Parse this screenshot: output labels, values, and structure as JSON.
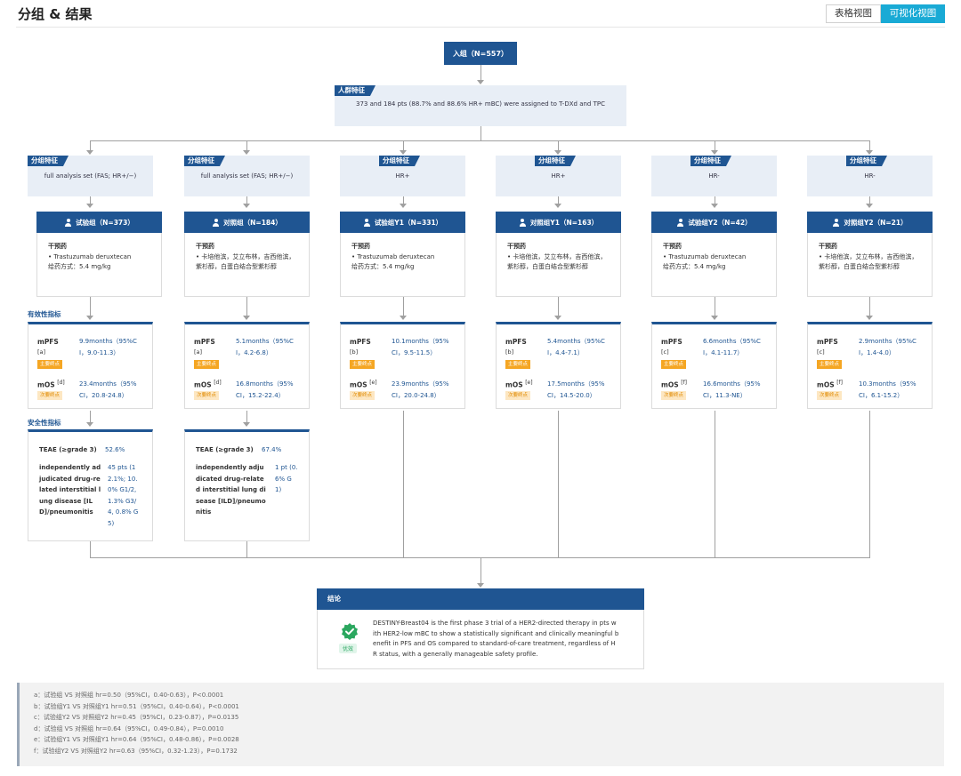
{
  "header": {
    "title": "分组 & 结果",
    "table_view": "表格视图",
    "visual_view": "可视化视图"
  },
  "enroll": {
    "label": "入组（N=557）"
  },
  "population": {
    "tag": "人群特征",
    "text": "373 and 184 pts (88.7% and 88.6% HR+ mBC) were assigned to T-DXd and TPC"
  },
  "groups": [
    {
      "tag": "分组特征",
      "text": "full analysis set (FAS; HR+/−)"
    },
    {
      "tag": "分组特征",
      "text": "full analysis set (FAS; HR+/−)"
    },
    {
      "tag": "分组特征",
      "text": "HR+"
    },
    {
      "tag": "分组特征",
      "text": "HR+"
    },
    {
      "tag": "分组特征",
      "text": "HR-"
    },
    {
      "tag": "分组特征",
      "text": "HR-"
    }
  ],
  "arms": [
    {
      "name": "试验组（N=373）",
      "intervention_label": "干预药",
      "drug": "• Trastuzumab deruxtecan",
      "dose": "给药方式：5.4 mg/kg"
    },
    {
      "name": "对照组（N=184）",
      "intervention_label": "干预药",
      "drug": "• 卡培他滨，艾立布林，吉西他滨，紫杉醇，白蛋白结合型紫杉醇",
      "dose": ""
    },
    {
      "name": "试验组Y1（N=331）",
      "intervention_label": "干预药",
      "drug": "• Trastuzumab deruxtecan",
      "dose": "给药方式：5.4 mg/kg"
    },
    {
      "name": "对照组Y1（N=163）",
      "intervention_label": "干预药",
      "drug": "• 卡培他滨，艾立布林，吉西他滨，紫杉醇，白蛋白结合型紫杉醇",
      "dose": ""
    },
    {
      "name": "试验组Y2（N=42）",
      "intervention_label": "干预药",
      "drug": "• Trastuzumab deruxtecan",
      "dose": "给药方式：5.4 mg/kg"
    },
    {
      "name": "对照组Y2（N=21）",
      "intervention_label": "干预药",
      "drug": "• 卡培他滨，艾立布林，吉西他滨，紫杉醇，白蛋白结合型紫杉醇",
      "dose": ""
    }
  ],
  "efficacy_title": "有效性指标",
  "safety_title": "安全性指标",
  "efficacy": [
    {
      "mpfs_label": "mPFS",
      "mpfs_ref": "[a]",
      "mpfs_l1": "9.9months（95%C",
      "mpfs_l2": "I，9.0-11.3）",
      "primary": "主要终点",
      "mos_label": "mOS",
      "mos_ref": "[d]",
      "mos_l1": "23.4months（95%",
      "mos_l2": "CI，20.8-24.8）",
      "secondary": "次要终点"
    },
    {
      "mpfs_label": "mPFS",
      "mpfs_ref": "[a]",
      "mpfs_l1": "5.1months（95%C",
      "mpfs_l2": "I，4.2-6.8）",
      "primary": "主要终点",
      "mos_label": "mOS",
      "mos_ref": "[d]",
      "mos_l1": "16.8months（95%",
      "mos_l2": "CI，15.2-22.4）",
      "secondary": "次要终点"
    },
    {
      "mpfs_label": "mPFS",
      "mpfs_ref": "[b]",
      "mpfs_l1": "10.1months（95%",
      "mpfs_l2": "CI，9.5-11.5）",
      "primary": "主要终点",
      "mos_label": "mOS",
      "mos_ref": "[e]",
      "mos_l1": "23.9months（95%",
      "mos_l2": "CI，20.0-24.8）",
      "secondary": "次要终点"
    },
    {
      "mpfs_label": "mPFS",
      "mpfs_ref": "[b]",
      "mpfs_l1": "5.4months（95%C",
      "mpfs_l2": "I，4.4-7.1）",
      "primary": "主要终点",
      "mos_label": "mOS",
      "mos_ref": "[e]",
      "mos_l1": "17.5months（95%",
      "mos_l2": "CI，14.5-20.0）",
      "secondary": "次要终点"
    },
    {
      "mpfs_label": "mPFS",
      "mpfs_ref": "[c]",
      "mpfs_l1": "6.6months（95%C",
      "mpfs_l2": "I，4.1-11.7）",
      "primary": "主要终点",
      "mos_label": "mOS",
      "mos_ref": "[f]",
      "mos_l1": "16.6months（95%",
      "mos_l2": "CI，11.3-NE）",
      "secondary": "次要终点"
    },
    {
      "mpfs_label": "mPFS",
      "mpfs_ref": "[c]",
      "mpfs_l1": "2.9months（95%C",
      "mpfs_l2": "I，1.4-4.0）",
      "primary": "主要终点",
      "mos_label": "mOS",
      "mos_ref": "[f]",
      "mos_l1": "10.3months（95%",
      "mos_l2": "CI，6.1-15.2）",
      "secondary": "次要终点"
    }
  ],
  "safety": [
    {
      "teae_label": "TEAE (≥grade 3)",
      "teae_value": "52.6%",
      "ild_label": [
        "independently ad",
        "judicated drug-re",
        "lated interstitial l",
        "ung disease [IL",
        "D]/pneumonitis"
      ],
      "ild_value": [
        "45 pts (1",
        "2.1%; 10.",
        "0% G1/2,",
        "1.3% G3/",
        "4, 0.8% G",
        "5)"
      ]
    },
    {
      "teae_label": "TEAE (≥grade 3)",
      "teae_value": "67.4%",
      "ild_label": [
        "independently adju",
        "dicated drug-relate",
        "d interstitial lung di",
        "sease [ILD]/pneumo",
        "nitis"
      ],
      "ild_value": [
        "1 pt (0.",
        "6% G",
        "1)"
      ]
    }
  ],
  "conclusion": {
    "title": "结论",
    "badge": "优效",
    "lines": [
      "DESTINY-Breast04 is the first phase 3 trial of a HER2-directed therapy in pts w",
      "ith HER2-low mBC to show a statistically significant and clinically meaningful b",
      "enefit in PFS and OS compared to standard-of-care treatment, regardless of H",
      "R status, with a generally manageable safety profile."
    ]
  },
  "footnotes": [
    "a：试验组 VS 对照组 hr=0.50（95%CI，0.40-0.63），P<0.0001",
    "b：试验组Y1 VS 对照组Y1 hr=0.51（95%CI，0.40-0.64），P<0.0001",
    "c：试验组Y2 VS 对照组Y2 hr=0.45（95%CI，0.23-0.87），P=0.0135",
    "d：试验组 VS 对照组 hr=0.64（95%CI，0.49-0.84），P=0.0010",
    "e：试验组Y1 VS 对照组Y1 hr=0.64（95%CI，0.48-0.86），P=0.0028",
    "f：试验组Y2 VS 对照组Y2 hr=0.63（95%CI，0.32-1.23），P=0.1732"
  ]
}
